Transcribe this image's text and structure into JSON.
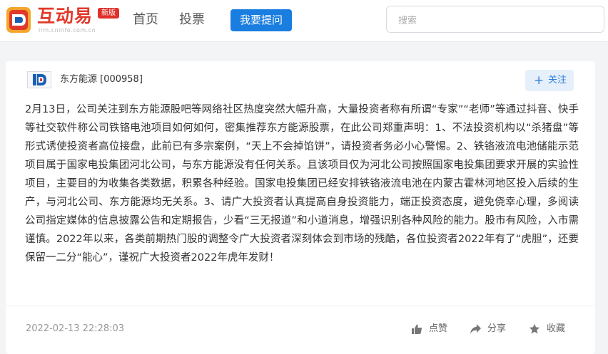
{
  "header": {
    "logo_text": "互动易",
    "logo_sub": "irm.cninfo.com.cn",
    "logo_badge": "新版",
    "nav": [
      {
        "label": "首页"
      },
      {
        "label": "投票"
      }
    ],
    "ask_button": "我要提问",
    "search_placeholder": "搜索"
  },
  "post": {
    "company": "东方能源 [000958]",
    "follow_label": "关注",
    "content": "2月13日，公司关注到东方能源股吧等网络社区热度突然大幅升高，大量投资者称有所谓“专家”“老师”等通过抖音、快手等社交软件称公司铁铬电池项目如何如何，密集推荐东方能源股票，在此公司郑重声明：1、不法投资机构以“杀猪盘”等形式诱使投资者高位接盘，此前已有多宗案例，“天上不会掉馅饼”，请投资者务必小心警惕。2、铁铬液流电池储能示范项目属于国家电投集团河北公司，与东方能源没有任何关系。且该项目仅为河北公司按照国家电投集团要求开展的实验性项目，主要目的为收集各类数据，积累各种经验。国家电投集团已经安排铁铬液流电池在内蒙古霍林河地区投入后续的生产，与河北公司、东方能源均无关系。3、请广大投资者认真提高自身投资能力，端正投资态度，避免侥幸心理，多阅读公司指定媒体的信息披露公告和定期报告，少看“三无报道”和小道消息，增强识别各种风险的能力。股市有风险，入市需谨慎。2022年以来，各类前期热门股的调整令广大投资者深刻体会到市场的残酷，各位投资者2022年有了“虎胆”，还要保留一二分“能心”，谨祝广大投资者2022年虎年发财！",
    "date": "2022-02-13 22:28:03",
    "actions": {
      "like": "点赞",
      "share": "分享",
      "favorite": "收藏"
    }
  },
  "colors": {
    "accent": "#1a7de0",
    "brand_red": "#e03a2a",
    "follow_bg": "#e6f0fb"
  }
}
